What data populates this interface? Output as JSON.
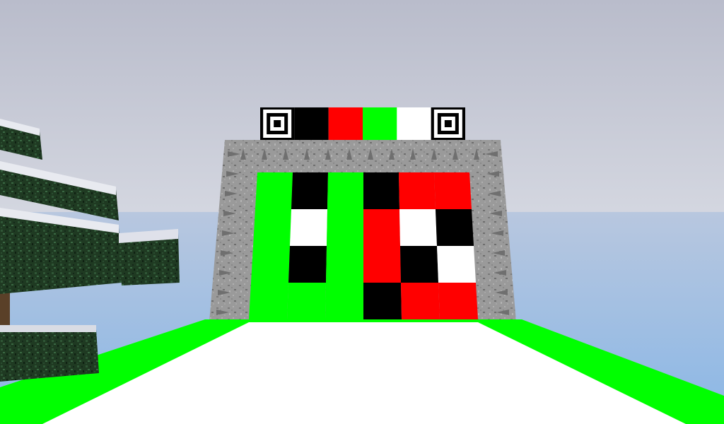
{
  "colors": {
    "sky_top": "#b9bccb",
    "sky_bottom": "#d6d9e2",
    "ocean": "#8ab7e6",
    "ocean_far": "#b8c7df",
    "stone": "#9a9a9a",
    "stone_dark": "#6f6f6f",
    "green": "#00ff00",
    "red": "#ff0000",
    "black": "#000000",
    "white": "#ffffff",
    "snow": "#ffffff",
    "leaf": "#1f3a22",
    "leaf_light": "#2e5233",
    "trunk": "#5a4028"
  },
  "marker_strip": {
    "cells": [
      "target-marker",
      "black",
      "red",
      "green",
      "white",
      "target-marker"
    ]
  },
  "pattern_grid": {
    "rows": 4,
    "cols": 6,
    "cells": [
      [
        "green",
        "black",
        "green",
        "black",
        "red",
        "red"
      ],
      [
        "green",
        "white",
        "green",
        "red",
        "white",
        "black"
      ],
      [
        "green",
        "black",
        "green",
        "red",
        "black",
        "white"
      ],
      [
        "green",
        "green",
        "green",
        "black",
        "red",
        "red"
      ]
    ]
  },
  "floor": {
    "path_color": "white",
    "edge_color": "green"
  },
  "tree": {
    "type": "snowy-spruce",
    "side": "left"
  }
}
